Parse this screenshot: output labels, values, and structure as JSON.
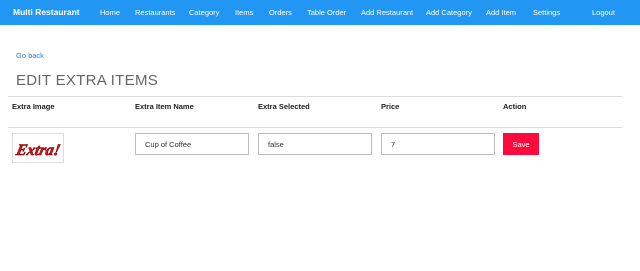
{
  "navbar": {
    "brand": "Multi Restaurant",
    "items": [
      "Home",
      "Restaurants",
      "Category",
      "Items",
      "Orders",
      "Table Order",
      "Add Restaurant",
      "Add Category",
      "Add Item",
      "Settings"
    ],
    "logout": "Logout",
    "color": "#2196f3"
  },
  "go_back": "Go back",
  "title": "EDIT EXTRA ITEMS",
  "table": {
    "headers": [
      "Extra Image",
      "Extra Item Name",
      "Extra Selected",
      "Price",
      "Action"
    ],
    "row": {
      "image_text": "Extra!",
      "name": "Cup of Coffee",
      "selected": "false",
      "price": "7",
      "action_label": "Save"
    }
  },
  "colors": {
    "save_button": "#ff0a3c",
    "link": "#2a7bd6"
  }
}
